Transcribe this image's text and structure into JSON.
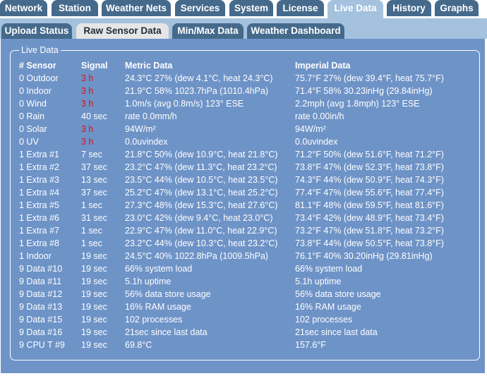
{
  "main_tabs": [
    {
      "label": "Network"
    },
    {
      "label": "Station"
    },
    {
      "label": "Weather Nets"
    },
    {
      "label": "Services"
    },
    {
      "label": "System"
    },
    {
      "label": "License"
    },
    {
      "label": "Live Data",
      "active": true
    },
    {
      "label": "History"
    },
    {
      "label": "Graphs"
    }
  ],
  "sub_tabs": [
    {
      "label": "Upload Status"
    },
    {
      "label": "Raw Sensor Data",
      "active": true
    },
    {
      "label": "Min/Max Data"
    },
    {
      "label": "Weather Dashboard"
    }
  ],
  "live_data": {
    "legend": "Live Data",
    "headers": {
      "sensor": "# Sensor",
      "signal": "Signal",
      "metric": "Metric Data",
      "imperial": "Imperial Data"
    },
    "rows": [
      {
        "sensor": "0 Outdoor",
        "signal": "3 h",
        "signal_alert": true,
        "metric": "24.3°C 27% (dew 4.1°C, heat 24.3°C)",
        "imperial": "75.7°F 27% (dew 39.4°F, heat 75.7°F)"
      },
      {
        "sensor": "0 Indoor",
        "signal": "3 h",
        "signal_alert": true,
        "metric": "21.9°C 58% 1023.7hPa (1010.4hPa)",
        "imperial": "71.4°F 58% 30.23inHg (29.84inHg)"
      },
      {
        "sensor": "0 Wind",
        "signal": "3 h",
        "signal_alert": true,
        "metric": "1.0m/s (avg 0.8m/s) 123° ESE",
        "imperial": "2.2mph (avg 1.8mph) 123° ESE"
      },
      {
        "sensor": "0 Rain",
        "signal": "40 sec",
        "signal_alert": false,
        "metric": "rate 0.0mm/h",
        "imperial": "rate 0.00in/h"
      },
      {
        "sensor": "0 Solar",
        "signal": "3 h",
        "signal_alert": true,
        "metric": "94W/m²",
        "imperial": "94W/m²"
      },
      {
        "sensor": "0 UV",
        "signal": "3 h",
        "signal_alert": true,
        "metric": "0.0uvindex",
        "imperial": "0.0uvindex"
      },
      {
        "sensor": "1 Extra #1",
        "signal": "7 sec",
        "signal_alert": false,
        "metric": "21.8°C 50% (dew 10.9°C, heat 21.8°C)",
        "imperial": "71.2°F 50% (dew 51.6°F, heat 71.2°F)"
      },
      {
        "sensor": "1 Extra #2",
        "signal": "37 sec",
        "signal_alert": false,
        "metric": "23.2°C 47% (dew 11.3°C, heat 23.2°C)",
        "imperial": "73.8°F 47% (dew 52.3°F, heat 73.8°F)"
      },
      {
        "sensor": "1 Extra #3",
        "signal": "13 sec",
        "signal_alert": false,
        "metric": "23.5°C 44% (dew 10.5°C, heat 23.5°C)",
        "imperial": "74.3°F 44% (dew 50.9°F, heat 74.3°F)"
      },
      {
        "sensor": "1 Extra #4",
        "signal": "37 sec",
        "signal_alert": false,
        "metric": "25.2°C 47% (dew 13.1°C, heat 25.2°C)",
        "imperial": "77.4°F 47% (dew 55.6°F, heat 77.4°F)"
      },
      {
        "sensor": "1 Extra #5",
        "signal": "1 sec",
        "signal_alert": false,
        "metric": "27.3°C 48% (dew 15.3°C, heat 27.6°C)",
        "imperial": "81.1°F 48% (dew 59.5°F, heat 81.6°F)"
      },
      {
        "sensor": "1 Extra #6",
        "signal": "31 sec",
        "signal_alert": false,
        "metric": "23.0°C 42% (dew 9.4°C, heat 23.0°C)",
        "imperial": "73.4°F 42% (dew 48.9°F, heat 73.4°F)"
      },
      {
        "sensor": "1 Extra #7",
        "signal": "1 sec",
        "signal_alert": false,
        "metric": "22.9°C 47% (dew 11.0°C, heat 22.9°C)",
        "imperial": "73.2°F 47% (dew 51.8°F, heat 73.2°F)"
      },
      {
        "sensor": "1 Extra #8",
        "signal": "1 sec",
        "signal_alert": false,
        "metric": "23.2°C 44% (dew 10.3°C, heat 23.2°C)",
        "imperial": "73.8°F 44% (dew 50.5°F, heat 73.8°F)"
      },
      {
        "sensor": "1 Indoor",
        "signal": "19 sec",
        "signal_alert": false,
        "metric": "24.5°C 40% 1022.8hPa (1009.5hPa)",
        "imperial": "76.1°F 40% 30.20inHg (29.81inHg)"
      },
      {
        "sensor": "9 Data #10",
        "signal": "19 sec",
        "signal_alert": false,
        "metric": "66% system load",
        "imperial": "66% system load"
      },
      {
        "sensor": "9 Data #11",
        "signal": "19 sec",
        "signal_alert": false,
        "metric": "5.1h uptime",
        "imperial": "5.1h uptime"
      },
      {
        "sensor": "9 Data #12",
        "signal": "19 sec",
        "signal_alert": false,
        "metric": "56% data store usage",
        "imperial": "56% data store usage"
      },
      {
        "sensor": "9 Data #13",
        "signal": "19 sec",
        "signal_alert": false,
        "metric": "16% RAM usage",
        "imperial": "16% RAM usage"
      },
      {
        "sensor": "9 Data #15",
        "signal": "19 sec",
        "signal_alert": false,
        "metric": "102 processes",
        "imperial": "102 processes"
      },
      {
        "sensor": "9 Data #16",
        "signal": "19 sec",
        "signal_alert": false,
        "metric": "21sec since last data",
        "imperial": "21sec since last data"
      },
      {
        "sensor": "9 CPU T #9",
        "signal": "19 sec",
        "signal_alert": false,
        "metric": "69.8°C",
        "imperial": "157.6°F"
      }
    ]
  },
  "colors": {
    "tab_bg": "#456a8c",
    "tab_active_bg": "#a4c2de",
    "subtab_active_bg": "#e6e6e6",
    "panel_bg": "#6e93c7",
    "signal_alert": "#d8141a",
    "text": "#ffffff"
  }
}
